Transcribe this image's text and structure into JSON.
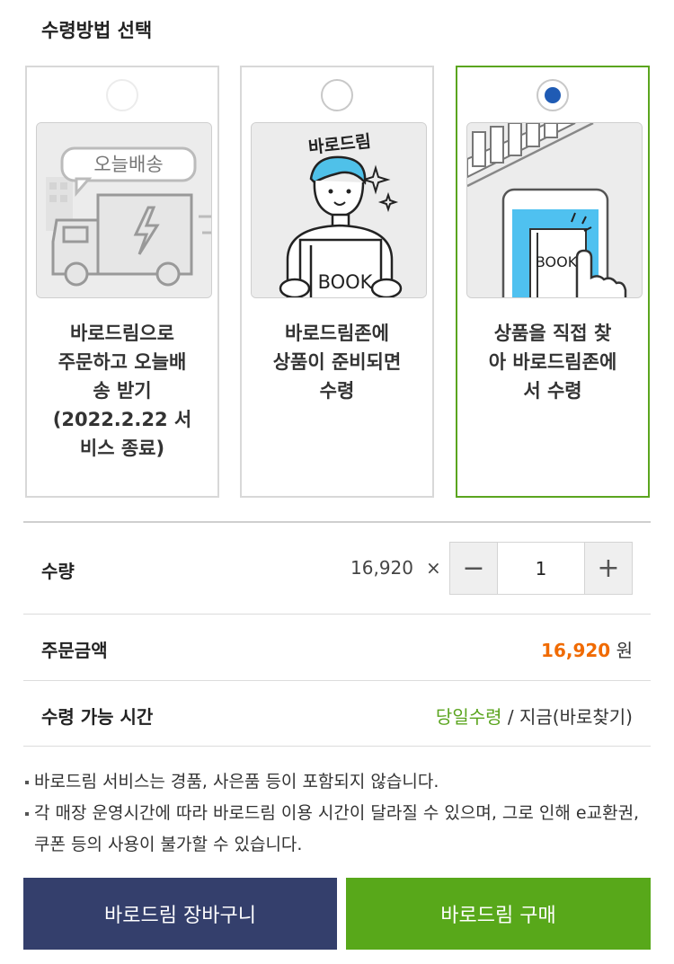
{
  "section_title": "수령방법 선택",
  "options": [
    {
      "lines": [
        "바로드림으로",
        "주문하고 오늘배",
        "송 받기",
        "(2022.2.22 서",
        "비스 종료)"
      ],
      "illustration_label": "오늘배송",
      "icon": "delivery-truck-icon",
      "selected": false,
      "disabled": true
    },
    {
      "lines": [
        "바로드림존에",
        "상품이 준비되면",
        "수령"
      ],
      "illustration_label": "바로드림",
      "illustration_book": "BOOK",
      "icon": "person-holding-book-icon",
      "selected": false,
      "disabled": false
    },
    {
      "lines": [
        "상품을 직접 찾",
        "아 바로드림존에",
        "서 수령"
      ],
      "illustration_book": "BOOK",
      "icon": "phone-tap-icon",
      "selected": true,
      "disabled": false
    }
  ],
  "quantity": {
    "label": "수량",
    "unit_price": "16,920",
    "times": "×",
    "minus": "−",
    "value": "1",
    "plus": "+"
  },
  "order_amount": {
    "label": "주문금액",
    "value": "16,920",
    "currency": "원"
  },
  "pickup_time": {
    "label": "수령 가능 시간",
    "highlight": "당일수령",
    "rest": " / 지금(바로찾기)"
  },
  "notes": [
    "바로드림 서비스는 경품, 사은품 등이 포함되지 않습니다.",
    "각 매장 운영시간에 따라 바로드림 이용 시간이 달라질 수 있으며, 그로 인해 e교환권, 쿠폰 등의 사용이 불가할 수 있습니다."
  ],
  "buttons": {
    "cart": "바로드림 장바구니",
    "buy": "바로드림 구매"
  },
  "colors": {
    "selected_border": "#5ba51f",
    "radio_dot": "#1f5bb4",
    "price_highlight": "#f06a00",
    "green_text": "#5ba51f",
    "cart_button": "#343f6c",
    "buy_button": "#58a81a"
  }
}
